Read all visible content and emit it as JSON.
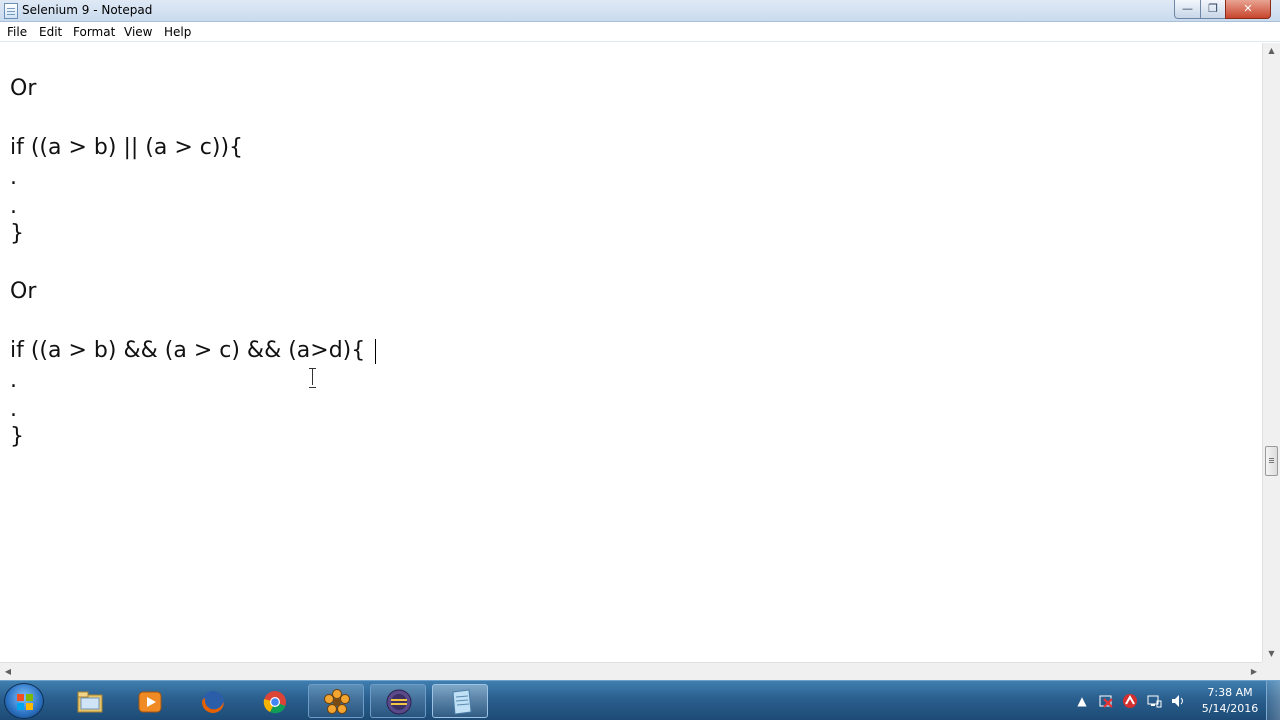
{
  "window": {
    "title": "Selenium 9 - Notepad",
    "minimize_symbol": "—",
    "maximize_symbol": "❐",
    "close_symbol": "✕"
  },
  "menu": {
    "items": [
      "File",
      "Edit",
      "Format",
      "View",
      "Help"
    ]
  },
  "editor": {
    "lines": [
      "Or",
      "if ((a > b) || (a > c)){",
      ".",
      ".",
      "}",
      "Or",
      "if ((a > b) && (a > c) && (a>d){",
      ".",
      ".",
      "}"
    ]
  },
  "scrollbar": {
    "up_arrow": "▲",
    "down_arrow": "▼",
    "left_arrow": "◀",
    "right_arrow": "▶"
  },
  "taskbar": {
    "start_label": "Start",
    "apps": [
      {
        "name": "windows-explorer",
        "icon": "folder-icon",
        "state": "pinned"
      },
      {
        "name": "media-player",
        "icon": "media-player-icon",
        "state": "pinned"
      },
      {
        "name": "firefox",
        "icon": "firefox-icon",
        "state": "pinned"
      },
      {
        "name": "chrome",
        "icon": "chrome-icon",
        "state": "pinned"
      },
      {
        "name": "flower-app",
        "icon": "flower-icon",
        "state": "open"
      },
      {
        "name": "java-ee-ide",
        "icon": "eclipse-java-ee-icon",
        "state": "open"
      },
      {
        "name": "notepad",
        "icon": "notepad-icon",
        "state": "active"
      }
    ],
    "tray": {
      "show_hidden": "▲",
      "time": "7:38 AM",
      "date": "5/14/2016"
    }
  },
  "colors": {
    "taskbar": "#2a5f8e",
    "text": "#111111",
    "editor_bg": "#ffffff"
  }
}
